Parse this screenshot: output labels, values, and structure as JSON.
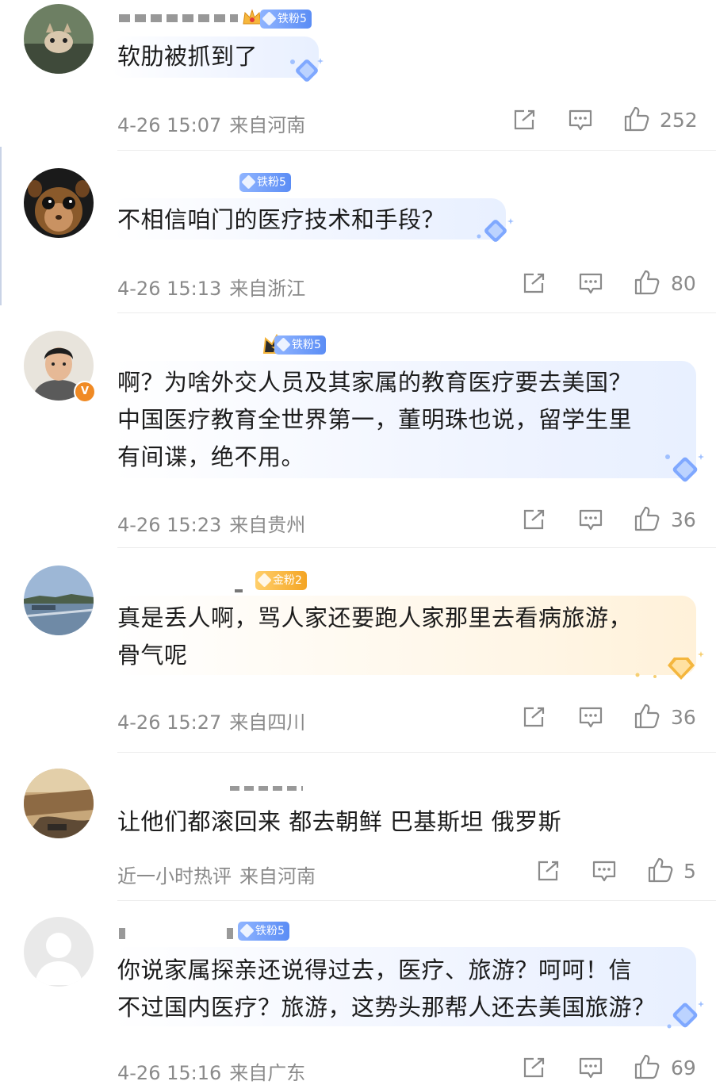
{
  "comments": [
    {
      "badge": "铁粉5",
      "text": "软肋被抓到了",
      "time": "4-26 15:07",
      "location": "来自河南",
      "likes": "252"
    },
    {
      "badge": "铁粉5",
      "text": "不相信咱门的医疗技术和手段？",
      "time": "4-26 15:13",
      "location": "来自浙江",
      "likes": "80"
    },
    {
      "badge": "铁粉5",
      "text_lines": [
        "啊？为啥外交人员及其家属的教育医疗要去美国？",
        "中国医疗教育全世界第一，董明珠也说，留学生里",
        "有间谍，绝不用。"
      ],
      "time": "4-26 15:23",
      "location": "来自贵州",
      "likes": "36"
    },
    {
      "badge": "金粉2",
      "text_lines": [
        "真是丢人啊，骂人家还要跑人家那里去看病旅游，",
        "骨气呢"
      ],
      "time": "4-26 15:27",
      "location": "来自四川",
      "likes": "36"
    },
    {
      "text": "让他们都滚回来 都去朝鲜 巴基斯坦 俄罗斯",
      "time": "近一小时热评",
      "location": "来自河南",
      "likes": "5"
    },
    {
      "badge": "铁粉5",
      "text_lines": [
        "你说家属探亲还说得过去，医疗、旅游？呵呵！信",
        "不过国内医疗？旅游，这势头那帮人还去美国旅游？"
      ],
      "time": "4-26 15:16",
      "location": "来自广东",
      "likes": "69"
    }
  ],
  "icons": {
    "share": "share-icon",
    "comment": "comment-icon",
    "like": "thumbs-up-icon"
  },
  "colors": {
    "meta_text": "#8a8a8a",
    "fan_blue": "#5b8df5",
    "fan_gold": "#f4a524",
    "verified": "#f08a24"
  }
}
